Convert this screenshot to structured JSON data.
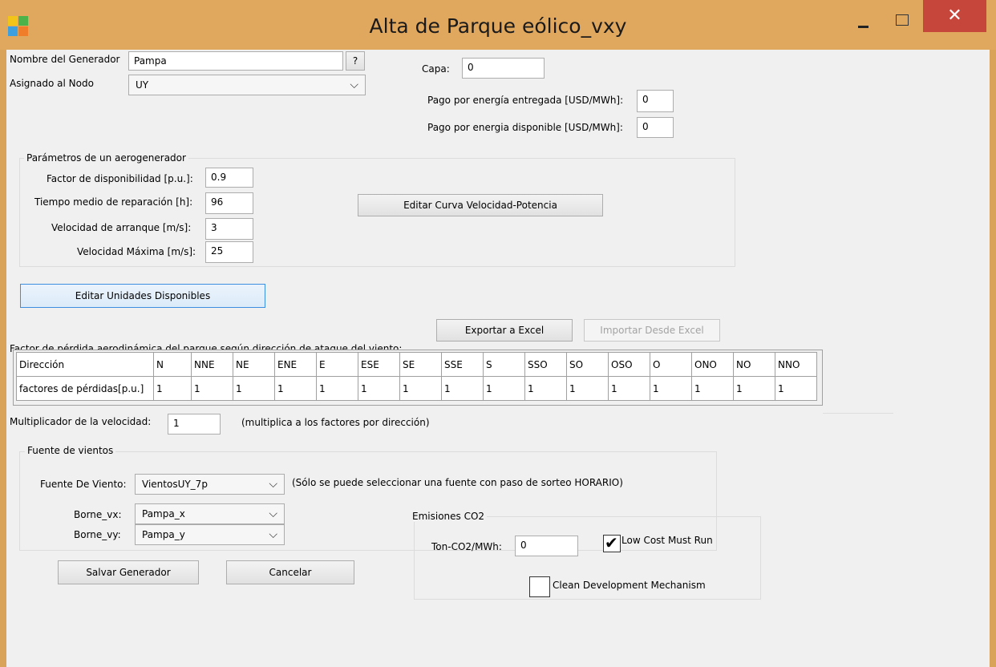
{
  "window": {
    "title": "Alta de Parque eólico_vxy",
    "close_label": "✕"
  },
  "general": {
    "nombre_label": "Nombre del Generador",
    "nombre_value": "Pampa",
    "help_label": "?",
    "nodo_label": "Asignado al Nodo",
    "nodo_value": "UY",
    "capa_label": "Capa:",
    "capa_value": "0",
    "pago_entregada_label": "Pago por energía entregada [USD/MWh]:",
    "pago_entregada_value": "0",
    "pago_disponible_label": "Pago por energia disponible [USD/MWh]:",
    "pago_disponible_value": "0"
  },
  "aero": {
    "group_label": "Parámetros de un aerogenerador",
    "factor_label": "Factor de disponibilidad [p.u.]:",
    "factor_value": "0.9",
    "tiempo_label": "Tiempo medio de reparación [h]:",
    "tiempo_value": "96",
    "arranque_label": "Velocidad  de arranque [m/s]:",
    "arranque_value": "3",
    "maxima_label": "Velocidad Máxima [m/s]:",
    "maxima_value": "25",
    "curva_button": "Editar Curva Velocidad-Potencia"
  },
  "unidades_button": "Editar Unidades Disponibles",
  "perdidas": {
    "caption": "Factor de pérdida aerodinámica del parque según dirección de ataque del viento:",
    "export_button": "Exportar a Excel",
    "import_button": "Importar Desde Excel",
    "row1_header": "Dirección",
    "row2_header": "factores de pérdidas[p.u.]",
    "directions": [
      "N",
      "NNE",
      "NE",
      "ENE",
      "E",
      "ESE",
      "SE",
      "SSE",
      "S",
      "SSO",
      "SO",
      "OSO",
      "O",
      "ONO",
      "NO",
      "NNO"
    ],
    "factors": [
      "1",
      "1",
      "1",
      "1",
      "1",
      "1",
      "1",
      "1",
      "1",
      "1",
      "1",
      "1",
      "1",
      "1",
      "1",
      "1"
    ]
  },
  "multiplicador": {
    "label": "Multiplicador de la velocidad:",
    "value": "1",
    "note": "(multiplica a los factores por dirección)"
  },
  "vientos": {
    "group_label": "Fuente de vientos",
    "fuente_label": "Fuente De Viento:",
    "fuente_value": "VientosUY_7p",
    "fuente_note": "(Sólo se puede seleccionar una fuente con paso de sorteo HORARIO)",
    "vx_label": "Borne_vx:",
    "vx_value": "Pampa_x",
    "vy_label": "Borne_vy:",
    "vy_value": "Pampa_y"
  },
  "emisiones": {
    "group_label": "Emisiones CO2",
    "ton_label": "Ton-CO2/MWh:",
    "ton_value": "0",
    "low_cost_label": "Low Cost Must Run",
    "low_cost_checked": true,
    "cdm_label": "Clean Development Mechanism",
    "cdm_checked": false
  },
  "actions": {
    "save_button": "Salvar Generador",
    "cancel_button": "Cancelar"
  }
}
